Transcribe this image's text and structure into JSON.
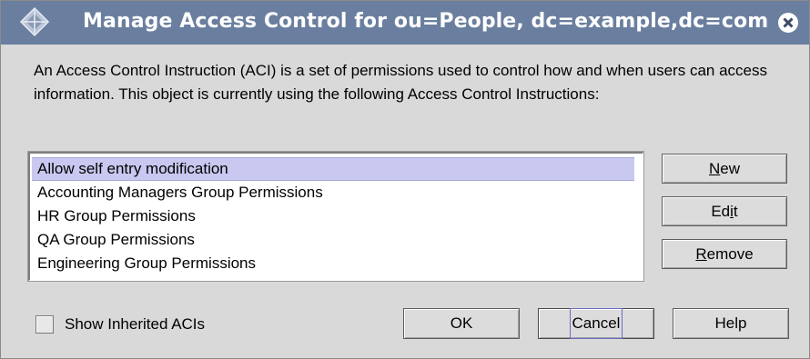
{
  "window": {
    "title": "Manage Access Control for ou=People, dc=example,dc=com"
  },
  "description": "An Access Control Instruction (ACI) is a set of permissions used to control how and when users can access information. This object is currently using the following Access Control Instructions:",
  "aci_list": {
    "items": [
      "Allow self entry modification",
      "Accounting Managers Group Permissions",
      "HR Group Permissions",
      "QA Group Permissions",
      "Engineering Group Permissions"
    ],
    "selected_index": 0
  },
  "side_buttons": {
    "new": {
      "pre": "",
      "mnemonic": "N",
      "post": "ew"
    },
    "edit": {
      "pre": "Ed",
      "mnemonic": "i",
      "post": "t"
    },
    "remove": {
      "pre": "",
      "mnemonic": "R",
      "post": "emove"
    }
  },
  "footer": {
    "show_inherited_label": "Show Inherited ACIs",
    "show_inherited_checked": false,
    "ok_label": "OK",
    "cancel_label": "Cancel",
    "help_label": "Help"
  },
  "icons": {
    "title": "app-diamond-icon",
    "close": "close-icon"
  },
  "colors": {
    "titlebar": "#6a7f9f",
    "selection": "#c8c8f0",
    "window_bg": "#d9d9d9"
  }
}
